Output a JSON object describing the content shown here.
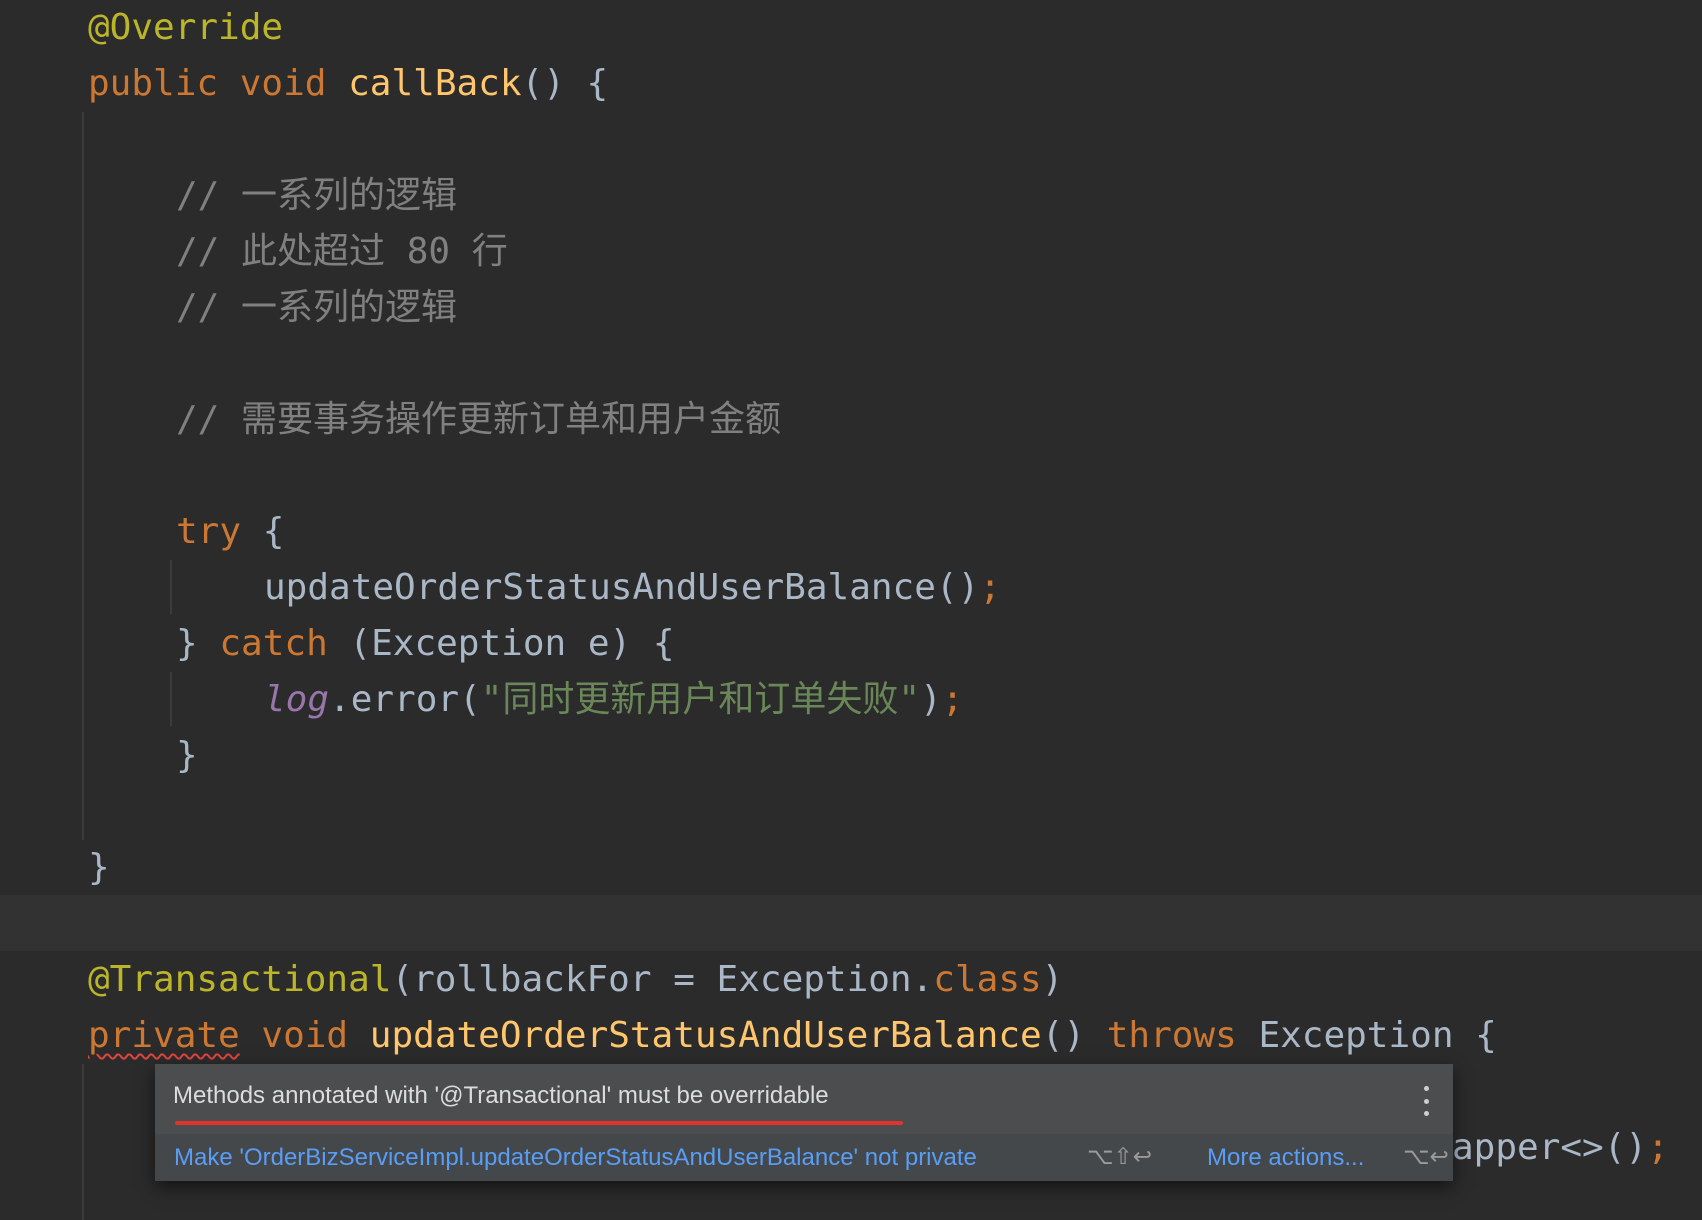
{
  "code": {
    "annotation_override": "@Override",
    "callback_kw_public": "public",
    "callback_kw_void": "void",
    "callback_name": "callBack",
    "callback_rest": "() {",
    "comment1": "// 一系列的逻辑",
    "comment2": "// 此处超过 80 行",
    "comment3": "// 一系列的逻辑",
    "comment4": "// 需要事务操作更新订单和用户金额",
    "try_kw": "try",
    "try_brace": " {",
    "call_method": "updateOrderStatusAndUserBalance()",
    "semicolon": ";",
    "close_brace": "}",
    "catch_kw": "catch",
    "catch_params": " (Exception e) {",
    "log_var": "log",
    "log_call": ".error(",
    "log_string": "\"同时更新用户和订单失败\"",
    "log_close": ")",
    "method_close_brace": "}",
    "transactional_annotation": "@Transactional",
    "transactional_args_open": "(rollbackFor = Exception.",
    "class_kw": "class",
    "transactional_args_close": ")",
    "private_kw": "private",
    "void_kw": "void",
    "method_name": "updateOrderStatusAndUserBalance",
    "method_parens": "() ",
    "throws_kw": "throws",
    "exception_rest": " Exception {",
    "partial_line": "apper<>()"
  },
  "popup": {
    "message": "Methods annotated with '@Transactional' must be overridable",
    "fix_action": "Make 'OrderBizServiceImpl.updateOrderStatusAndUserBalance' not private",
    "fix_shortcut": "⌥⇧↩",
    "more_actions": "More actions...",
    "more_shortcut": "⌥↩"
  },
  "colors": {
    "background": "#2b2b2b",
    "keyword": "#cc7832",
    "annotation": "#bbb529",
    "function": "#ffc66d",
    "comment": "#808080",
    "string": "#6a8759",
    "static_field": "#9876aa",
    "error_underline": "#e0342d",
    "link": "#589df6"
  }
}
